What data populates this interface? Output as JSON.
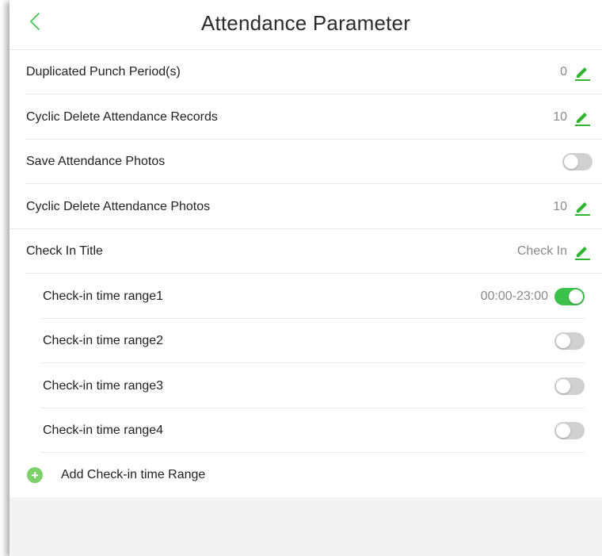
{
  "header": {
    "title": "Attendance Parameter",
    "back_icon": "chevron-left-icon"
  },
  "colors": {
    "accent": "#3cc24a",
    "edit_icon": "#2fb52f",
    "toggle_off": "#d0d0d0",
    "add_icon": "#7ed06a"
  },
  "settings": [
    {
      "label": "Duplicated Punch Period(s)",
      "value": "0",
      "control": "edit"
    },
    {
      "label": "Cyclic Delete Attendance Records",
      "value": "10",
      "control": "edit"
    },
    {
      "label": "Save Attendance Photos",
      "control": "toggle",
      "enabled": false
    },
    {
      "label": "Cyclic Delete Attendance Photos",
      "value": "10",
      "control": "edit"
    },
    {
      "label": "Check In Title",
      "value": "Check In",
      "control": "edit"
    }
  ],
  "time_ranges": [
    {
      "label": "Check-in time range1",
      "value": "00:00-23:00",
      "enabled": true
    },
    {
      "label": "Check-in time range2",
      "enabled": false
    },
    {
      "label": "Check-in time range3",
      "enabled": false
    },
    {
      "label": "Check-in time range4",
      "enabled": false
    }
  ],
  "add_range": {
    "label": "Add Check-in time Range",
    "icon": "plus-circle-icon"
  }
}
